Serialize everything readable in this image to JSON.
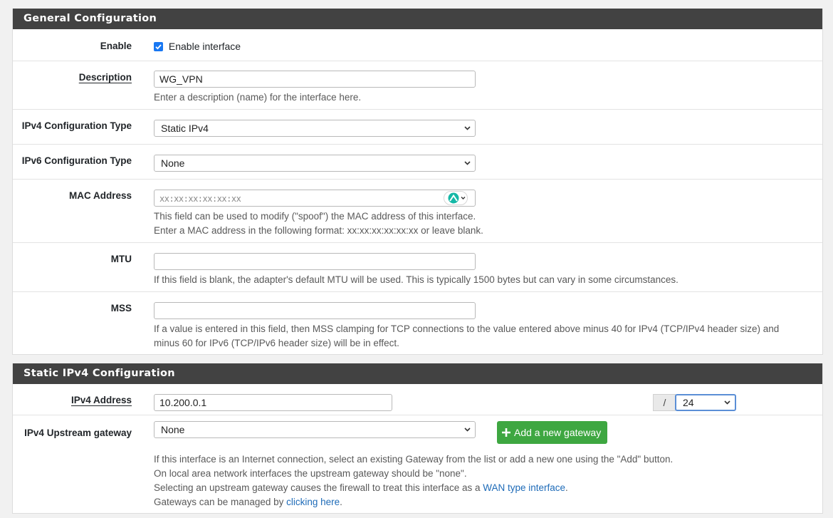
{
  "general": {
    "heading": "General Configuration",
    "enable": {
      "label": "Enable",
      "checkbox_label": "Enable interface",
      "checked": true
    },
    "description": {
      "label": "Description",
      "value": "WG_VPN",
      "help": "Enter a description (name) for the interface here."
    },
    "ipv4_type": {
      "label": "IPv4 Configuration Type",
      "value": "Static IPv4"
    },
    "ipv6_type": {
      "label": "IPv6 Configuration Type",
      "value": "None"
    },
    "mac": {
      "label": "MAC Address",
      "placeholder": "xx:xx:xx:xx:xx:xx",
      "help1": "This field can be used to modify (\"spoof\") the MAC address of this interface.",
      "help2": "Enter a MAC address in the following format: xx:xx:xx:xx:xx:xx or leave blank."
    },
    "mtu": {
      "label": "MTU",
      "value": "",
      "help": "If this field is blank, the adapter's default MTU will be used. This is typically 1500 bytes but can vary in some circumstances."
    },
    "mss": {
      "label": "MSS",
      "value": "",
      "help1": "If a value is entered in this field, then MSS clamping for TCP connections to the value entered above minus 40 for IPv4 (TCP/IPv4 header size) and",
      "help2": "minus 60 for IPv6 (TCP/IPv6 header size) will be in effect."
    }
  },
  "static_ipv4": {
    "heading": "Static IPv4 Configuration",
    "address": {
      "label": "IPv4 Address",
      "value": "10.200.0.1",
      "slash": "/",
      "prefix": "24"
    },
    "gateway": {
      "label": "IPv4 Upstream gateway",
      "value": "None",
      "add_button": "Add a new gateway",
      "help1": "If this interface is an Internet connection, select an existing Gateway from the list or add a new one using the \"Add\" button.",
      "help2": "On local area network interfaces the upstream gateway should be \"none\".",
      "help3_pre": "Selecting an upstream gateway causes the firewall to treat this interface as a ",
      "help3_link": "WAN type interface",
      "help3_post": ".",
      "help4_pre": "Gateways can be managed by ",
      "help4_link": "clicking here",
      "help4_post": "."
    }
  },
  "colors": {
    "heading_bg": "#424242",
    "accent": "#1877f2",
    "button_green": "#3ea741",
    "link": "#1e6bb8"
  }
}
